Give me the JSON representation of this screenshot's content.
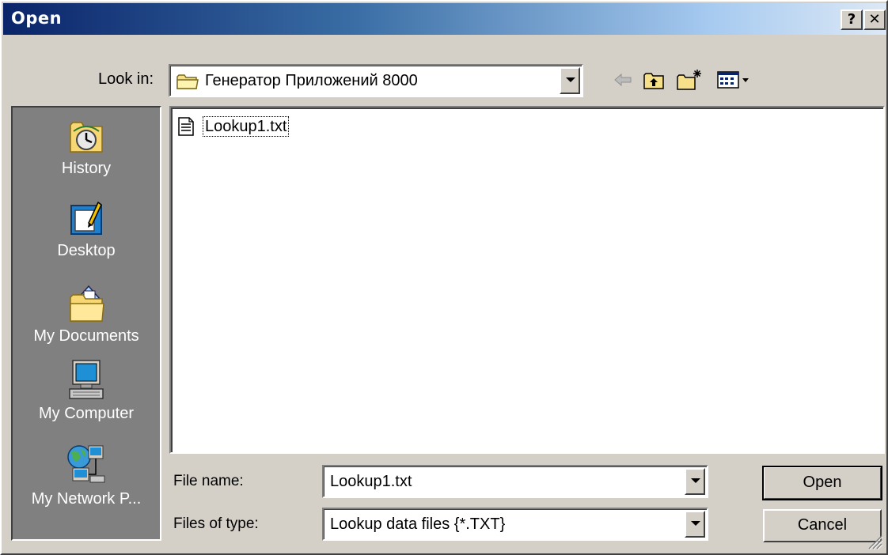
{
  "window": {
    "title": "Open",
    "help_button": "?",
    "close_button": "✕"
  },
  "look_in": {
    "label": "Look in:",
    "value": "Генератор Приложений 8000"
  },
  "toolbar": {
    "icons": [
      "back-arrow-icon",
      "up-one-level-icon",
      "create-new-folder-icon",
      "view-menu-icon"
    ]
  },
  "places": [
    {
      "label": "History",
      "icon": "history-icon"
    },
    {
      "label": "Desktop",
      "icon": "desktop-icon"
    },
    {
      "label": "My Documents",
      "icon": "my-documents-icon"
    },
    {
      "label": "My Computer",
      "icon": "my-computer-icon"
    },
    {
      "label": "My Network P...",
      "icon": "my-network-places-icon"
    }
  ],
  "files": [
    {
      "name": "Lookup1.txt",
      "icon": "text-file-icon"
    }
  ],
  "file_name": {
    "label": "File name:",
    "value": "Lookup1.txt"
  },
  "file_type": {
    "label": "Files of type:",
    "value": "Lookup data files {*.TXT}"
  },
  "buttons": {
    "open": "Open",
    "cancel": "Cancel"
  }
}
